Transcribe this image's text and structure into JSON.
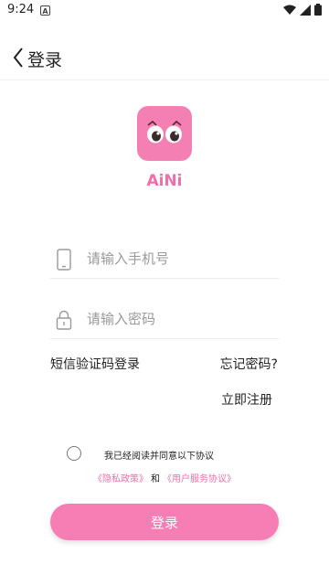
{
  "status_bar": {
    "time": "9:24",
    "notification_icon_letter": "A",
    "icons": [
      "wifi-icon",
      "signal-icon",
      "battery-icon"
    ]
  },
  "app_bar": {
    "title": "登录",
    "back_icon": "chevron-left-icon"
  },
  "brand": {
    "app_name": "AiNi",
    "logo_icon": "eyes-logo-icon",
    "accent_color": "#f06ea9",
    "logo_color": "#f47fb3"
  },
  "form": {
    "phone": {
      "placeholder": "请输入手机号",
      "value": "",
      "icon": "phone-icon"
    },
    "password": {
      "placeholder": "请输入密码",
      "value": "",
      "icon": "lock-icon"
    }
  },
  "links": {
    "sms_login": "短信验证码登录",
    "forgot_password": "忘记密码?",
    "register": "立即注册"
  },
  "agreement": {
    "text": "我已经阅读并同意以下协议",
    "privacy_policy": "《隐私政策》",
    "and": "和",
    "user_agreement": "《用户服务协议》",
    "checked": false
  },
  "actions": {
    "login_label": "登录",
    "button_color": "#f77db5"
  }
}
